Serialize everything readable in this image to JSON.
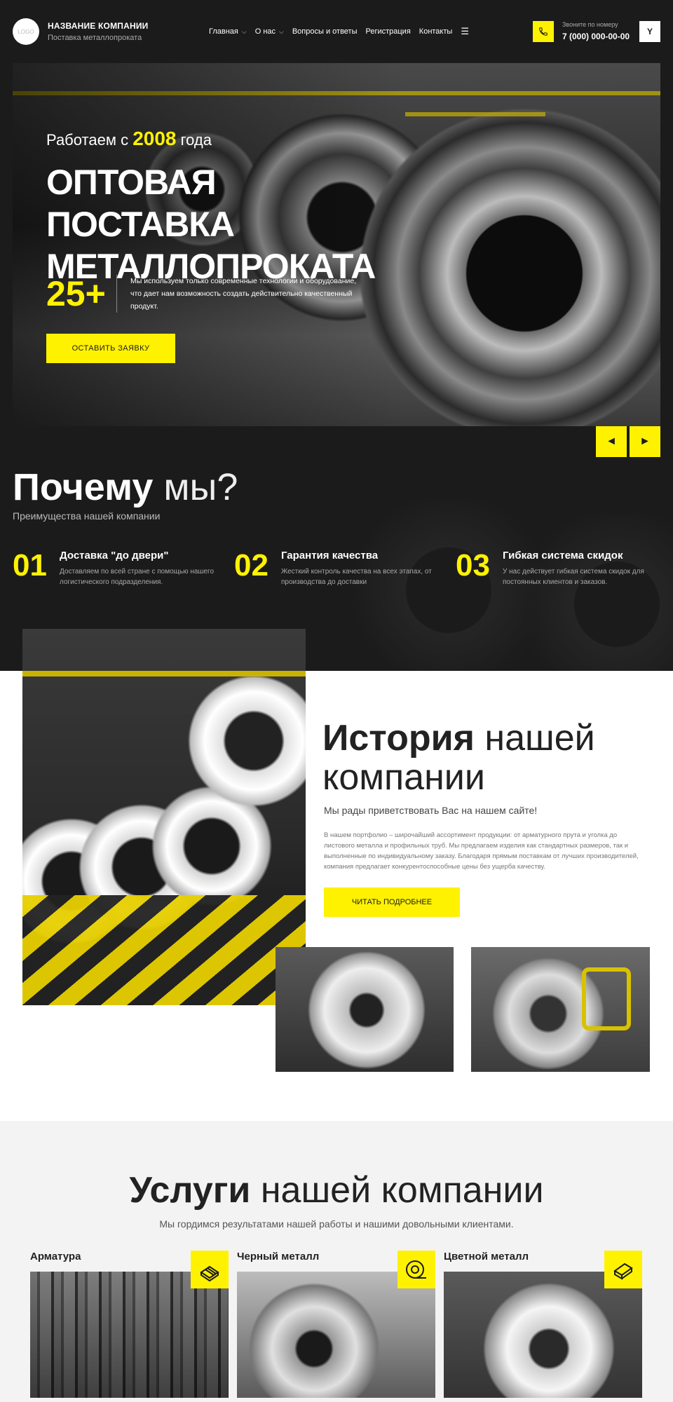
{
  "header": {
    "logo_text": "LOGO",
    "brand_name": "НАЗВАНИЕ КОМПАНИИ",
    "brand_sub": "Поставка металлопроката",
    "nav": [
      {
        "label": "Главная"
      },
      {
        "label": "О нас"
      },
      {
        "label": "Вопросы и ответы"
      },
      {
        "label": "Регистрация"
      },
      {
        "label": "Контакты"
      }
    ],
    "phone_label": "Звоните по номеру",
    "phone_number": "7 (000) 000-00-00",
    "lang": "Y"
  },
  "hero": {
    "since_prefix": "Работаем с",
    "since_year": "2008",
    "since_suffix": "года",
    "title": "ОПТОВАЯ ПОСТАВКА МЕТАЛЛОПРОКАТА",
    "stat": "25+",
    "text": "Мы используем только современные технологии и оборудование, что дает нам возможность создать действительно качественный продукт.",
    "cta": "ОСТАВИТЬ ЗАЯВКУ",
    "prev": "◄",
    "next": "►"
  },
  "why": {
    "title_bold": "Почему",
    "title_light": "мы?",
    "subtitle": "Преимущества нашей компании",
    "features": [
      {
        "num": "01",
        "title": "Доставка \"до двери\"",
        "text": "Доставляем по всей стране с помощью нашего логистического подразделения."
      },
      {
        "num": "02",
        "title": "Гарантия качества",
        "text": "Жесткий контроль качества на всех этапах, от производства до доставки"
      },
      {
        "num": "03",
        "title": "Гибкая система скидок",
        "text": "У нас действует гибкая система скидок для постоянных клиентов и заказов."
      }
    ]
  },
  "history": {
    "title_bold": "История",
    "title_light_1": "нашей",
    "title_light_2": "компании",
    "greeting": "Мы рады приветствовать Вас на нашем сайте!",
    "text": "В нашем портфолио – широчайший ассортимент продукции: от арматурного прута и уголка до листового металла и профильных труб. Мы предлагаем изделия как стандартных размеров, так и выполненные по индивидуальному заказу. Благодаря прямым поставкам от лучших производителей, компания предлагает конкурентоспособные цены без ущерба качеству.",
    "cta": "ЧИТАТЬ ПОДРОБНЕЕ"
  },
  "services": {
    "title_bold": "Услуги",
    "title_light": "нашей компании",
    "subtitle": "Мы гордимся результатами нашей работы и нашими довольными клиентами.",
    "items": [
      {
        "name": "Арматура",
        "icon": "rebar-icon"
      },
      {
        "name": "Черный металл",
        "icon": "coil-icon"
      },
      {
        "name": "Цветной металл",
        "icon": "metal-sheets-icon"
      }
    ]
  },
  "colors": {
    "accent": "#fff200",
    "dark": "#1b1b1b",
    "light_bg": "#f3f3f3"
  }
}
